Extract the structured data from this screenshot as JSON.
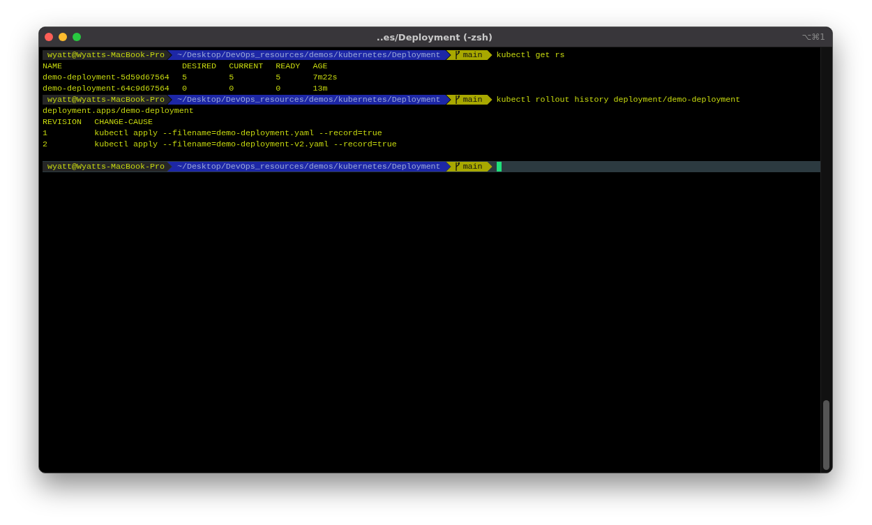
{
  "window": {
    "title": "..es/Deployment (-zsh)",
    "shortcut": "⌥⌘1"
  },
  "lines": [
    {
      "kind": "prompt",
      "user": "wyatt@Wyatts-MacBook-Pro",
      "path": "~/Desktop/DevOps_resources/demos/kubernetes/Deployment",
      "branch": "main",
      "command": "kubectl get rs",
      "active": false
    },
    {
      "kind": "table",
      "columns": [
        "NAME",
        "DESIRED",
        "CURRENT",
        "READY",
        "AGE"
      ],
      "rows": [
        [
          "demo-deployment-5d59d67564",
          "5",
          "5",
          "5",
          "7m22s"
        ],
        [
          "demo-deployment-64c9d67564",
          "0",
          "0",
          "0",
          "13m"
        ]
      ]
    },
    {
      "kind": "prompt",
      "user": "wyatt@Wyatts-MacBook-Pro",
      "path": "~/Desktop/DevOps_resources/demos/kubernetes/Deployment",
      "branch": "main",
      "command": "kubectl rollout history deployment/demo-deployment",
      "active": false
    },
    {
      "kind": "output",
      "text": "deployment.apps/demo-deployment"
    },
    {
      "kind": "table",
      "columns": [
        "REVISION",
        "CHANGE-CAUSE"
      ],
      "rows": [
        [
          "1",
          "kubectl apply --filename=demo-deployment.yaml --record=true"
        ],
        [
          "2",
          "kubectl apply --filename=demo-deployment-v2.yaml --record=true"
        ]
      ]
    },
    {
      "kind": "blank"
    },
    {
      "kind": "prompt",
      "user": "wyatt@Wyatts-MacBook-Pro",
      "path": "~/Desktop/DevOps_resources/demos/kubernetes/Deployment",
      "branch": "main",
      "active": true
    }
  ]
}
